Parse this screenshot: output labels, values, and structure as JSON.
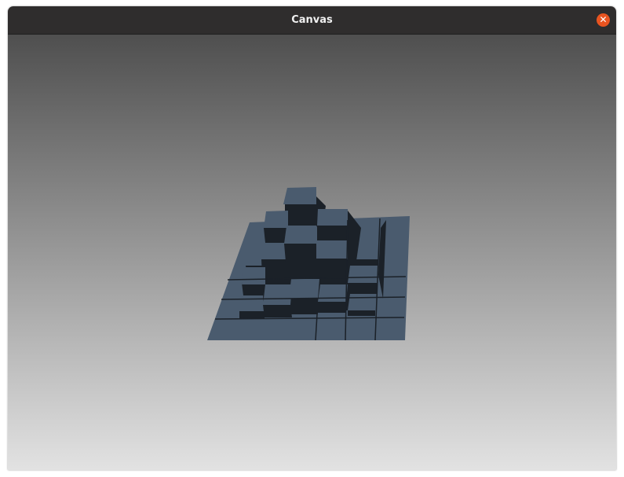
{
  "window": {
    "title": "Canvas",
    "close_icon": "close-icon"
  },
  "scene": {
    "block_top_color": "#4a5b6e",
    "block_side_color": "#1b2128"
  }
}
